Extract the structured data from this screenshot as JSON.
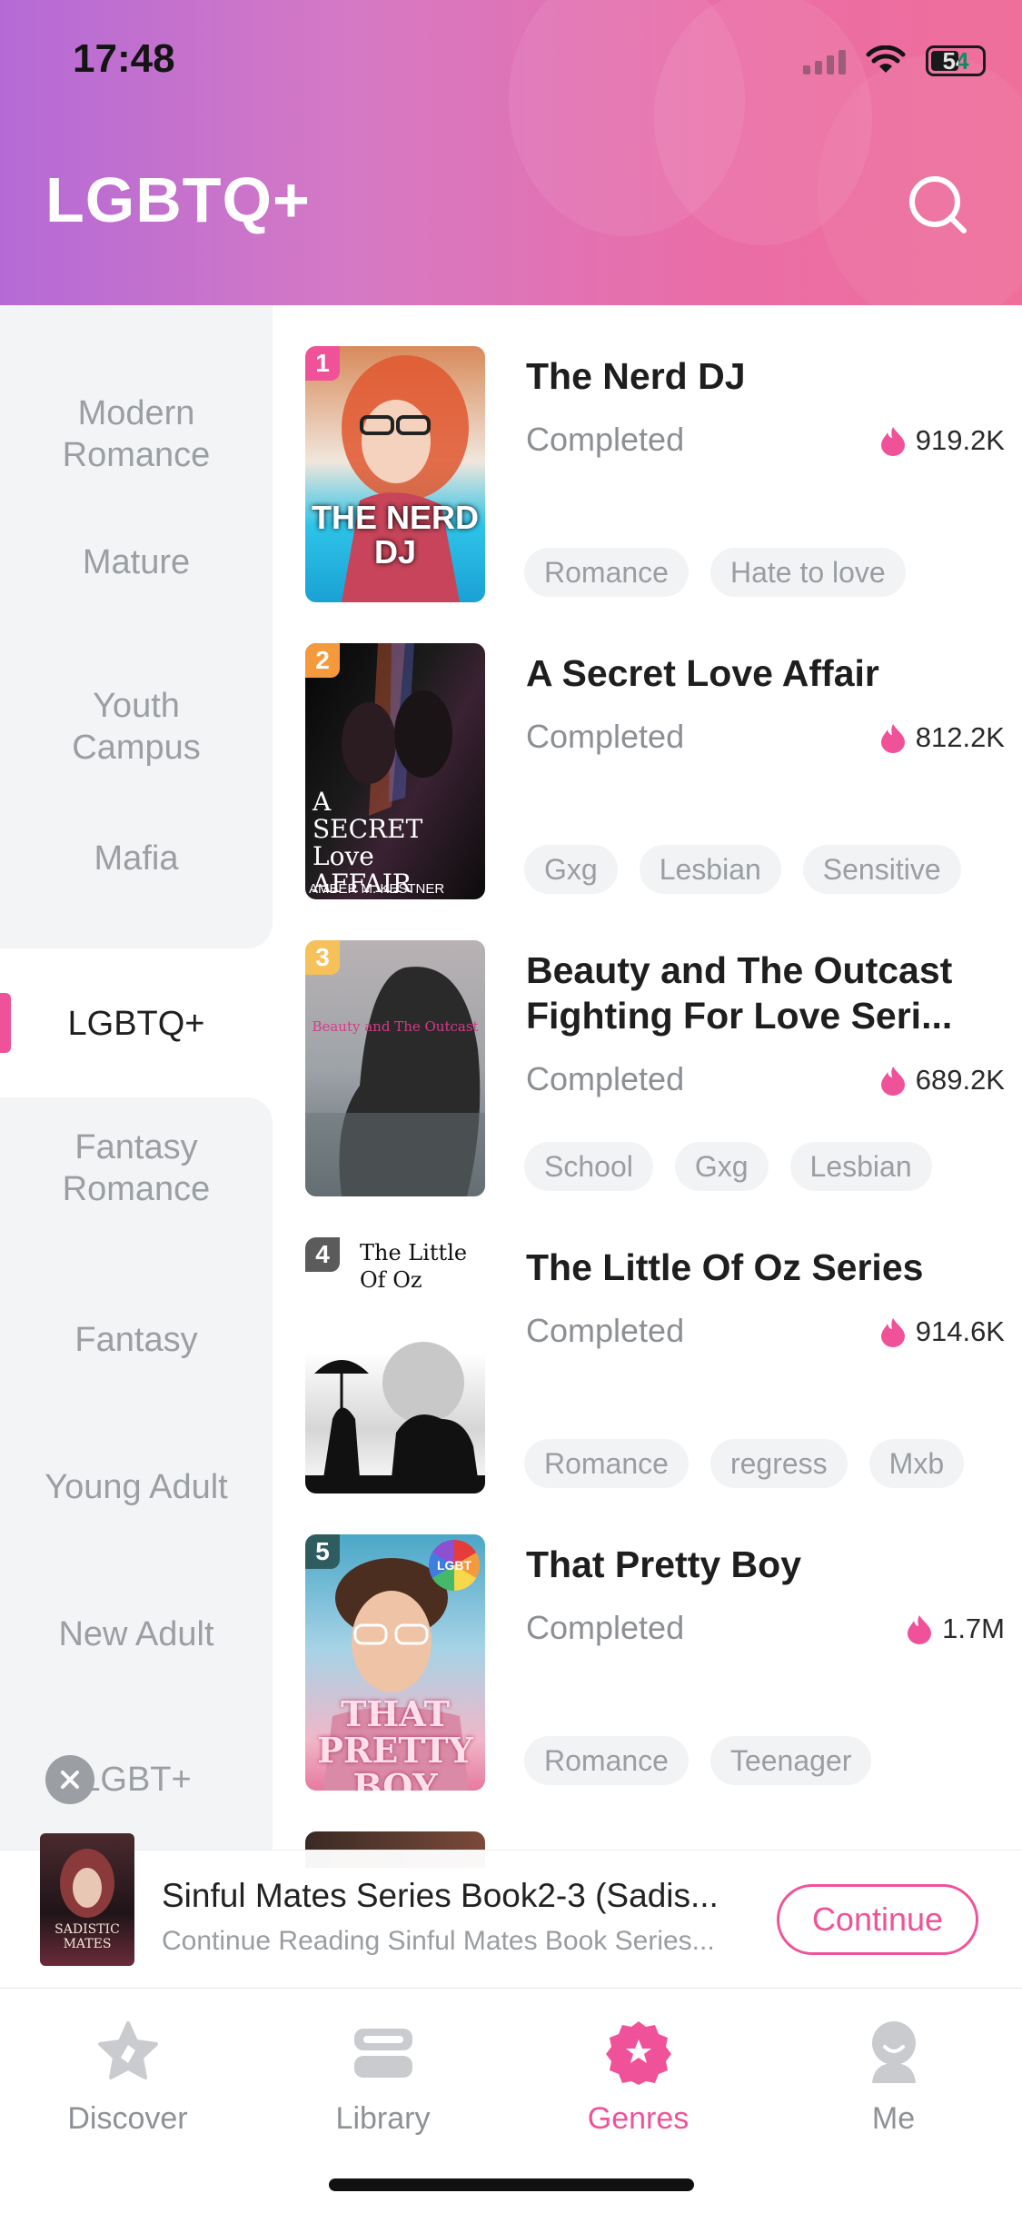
{
  "status_bar": {
    "time": "17:48",
    "battery": "54"
  },
  "header": {
    "title": "LGBTQ+"
  },
  "sidebar": {
    "items": [
      {
        "label": "Modern Romance",
        "active": false
      },
      {
        "label": "Mature",
        "active": false
      },
      {
        "label": "Youth Campus",
        "active": false
      },
      {
        "label": "Mafia",
        "active": false
      },
      {
        "label": "LGBTQ+",
        "active": true
      },
      {
        "label": "Fantasy Romance",
        "active": false
      },
      {
        "label": "Fantasy",
        "active": false
      },
      {
        "label": "Young Adult",
        "active": false
      },
      {
        "label": "New Adult",
        "active": false
      },
      {
        "label": "LGBT+",
        "active": false
      }
    ]
  },
  "books": [
    {
      "rank": "1",
      "title": "The Nerd DJ",
      "status": "Completed",
      "reads": "919.2K",
      "tags": [
        "Romance",
        "Hate to love"
      ],
      "cover_text": "THE NERD DJ",
      "rank_color": "#f0529a"
    },
    {
      "rank": "2",
      "title": "A Secret Love Affair",
      "status": "Completed",
      "reads": "812.2K",
      "tags": [
        "Gxg",
        "Lesbian",
        "Sensitive"
      ],
      "cover_text": "A SECRET Love AFFAIR",
      "cover_author": "AMBER M. KESTNER",
      "rank_color": "#f59a3c"
    },
    {
      "rank": "3",
      "title": "Beauty and The Outcast Fighting For Love Seri...",
      "status": "Completed",
      "reads": "689.2K",
      "tags": [
        "School",
        "Gxg",
        "Lesbian"
      ],
      "cover_text": "Beauty and The Outcast",
      "rank_color": "#f6c15a"
    },
    {
      "rank": "4",
      "title": "The Little Of Oz Series",
      "status": "Completed",
      "reads": "914.6K",
      "tags": [
        "Romance",
        "regress",
        "Mxb"
      ],
      "cover_text": "The Little Of Oz",
      "rank_color": "#5b5b5b"
    },
    {
      "rank": "5",
      "title": "That Pretty Boy",
      "status": "Completed",
      "reads": "1.7M",
      "tags": [
        "Romance",
        "Teenager"
      ],
      "cover_text": "THAT PRETTY BOY",
      "cover_badge": "LGBT",
      "rank_color": "#2f5d5f"
    }
  ],
  "continue_reading": {
    "title": "Sinful Mates Series Book2-3 (Sadis...",
    "subtitle": "Continue Reading Sinful Mates Book Series...",
    "button": "Continue",
    "cover_text": "SADISTIC MATES"
  },
  "tabbar": {
    "tabs": [
      {
        "label": "Discover",
        "icon": "discover-icon",
        "active": false
      },
      {
        "label": "Library",
        "icon": "library-icon",
        "active": false
      },
      {
        "label": "Genres",
        "icon": "genres-icon",
        "active": true
      },
      {
        "label": "Me",
        "icon": "me-icon",
        "active": false
      }
    ]
  },
  "colors": {
    "accent": "#f0529a",
    "header_start": "#b46ad6",
    "header_end": "#ef6f9a"
  }
}
